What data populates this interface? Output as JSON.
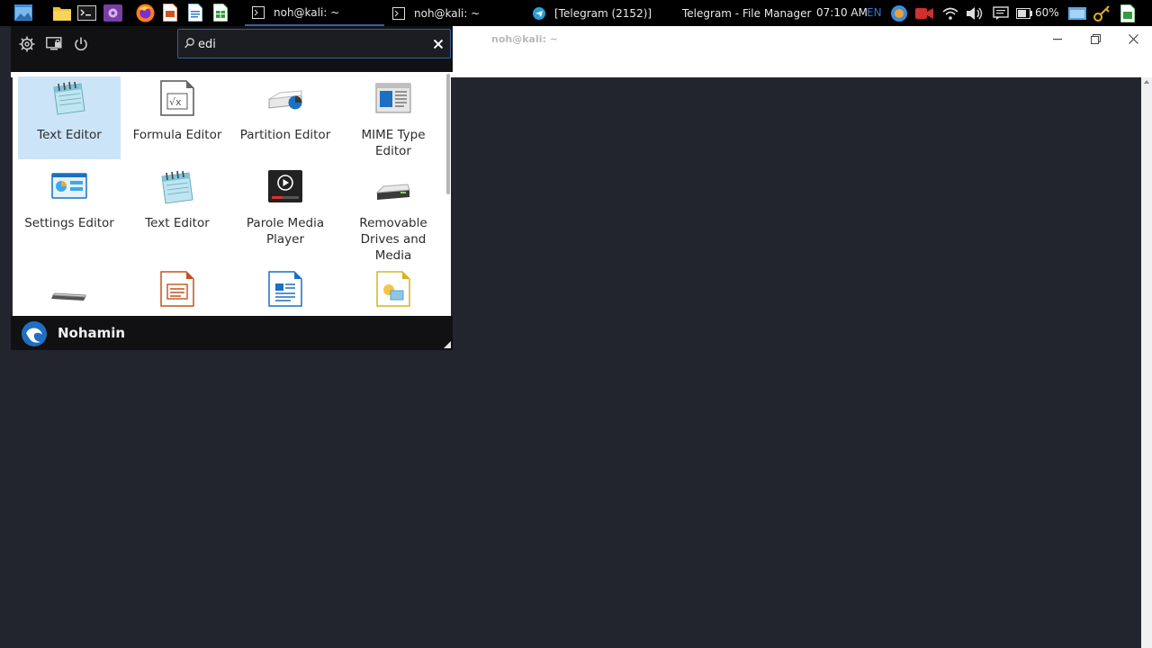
{
  "panel": {
    "tasks": [
      {
        "label": "noh@kali: ~",
        "active": true
      },
      {
        "label": "noh@kali: ~",
        "active": false
      },
      {
        "label": "[Telegram (2152)]",
        "active": false
      },
      {
        "label": "Telegram - File Manager",
        "active": false
      }
    ],
    "clock": "07:10 AM",
    "keyboard_layout": "EN",
    "battery": "60%"
  },
  "terminal": {
    "title": "noh@kali: ~"
  },
  "menu": {
    "search": {
      "value": "edi",
      "placeholder": ""
    },
    "results": [
      {
        "label": "Text Editor",
        "icon": "text-editor-icon",
        "selected": true
      },
      {
        "label": "Formula Editor",
        "icon": "formula-editor-icon"
      },
      {
        "label": "Partition Editor",
        "icon": "partition-editor-icon"
      },
      {
        "label": "MIME Type Editor",
        "icon": "mime-type-editor-icon"
      },
      {
        "label": "Settings Editor",
        "icon": "settings-editor-icon"
      },
      {
        "label": "Text Editor",
        "icon": "text-editor-icon"
      },
      {
        "label": "Parole Media Player",
        "icon": "media-player-icon"
      },
      {
        "label": "Removable Drives and Media",
        "icon": "removable-drive-icon"
      },
      {
        "label": "",
        "icon": "keyboard-icon"
      },
      {
        "label": "",
        "icon": "impress-icon"
      },
      {
        "label": "",
        "icon": "writer-icon"
      },
      {
        "label": "",
        "icon": "draw-icon"
      }
    ],
    "user": {
      "name": "Nohamin"
    }
  },
  "colors": {
    "panel_bg": "#000000",
    "terminal_bg": "#23252e",
    "menu_dark": "#111114",
    "selection": "#cce4f7",
    "accent": "#3a5f9a"
  }
}
